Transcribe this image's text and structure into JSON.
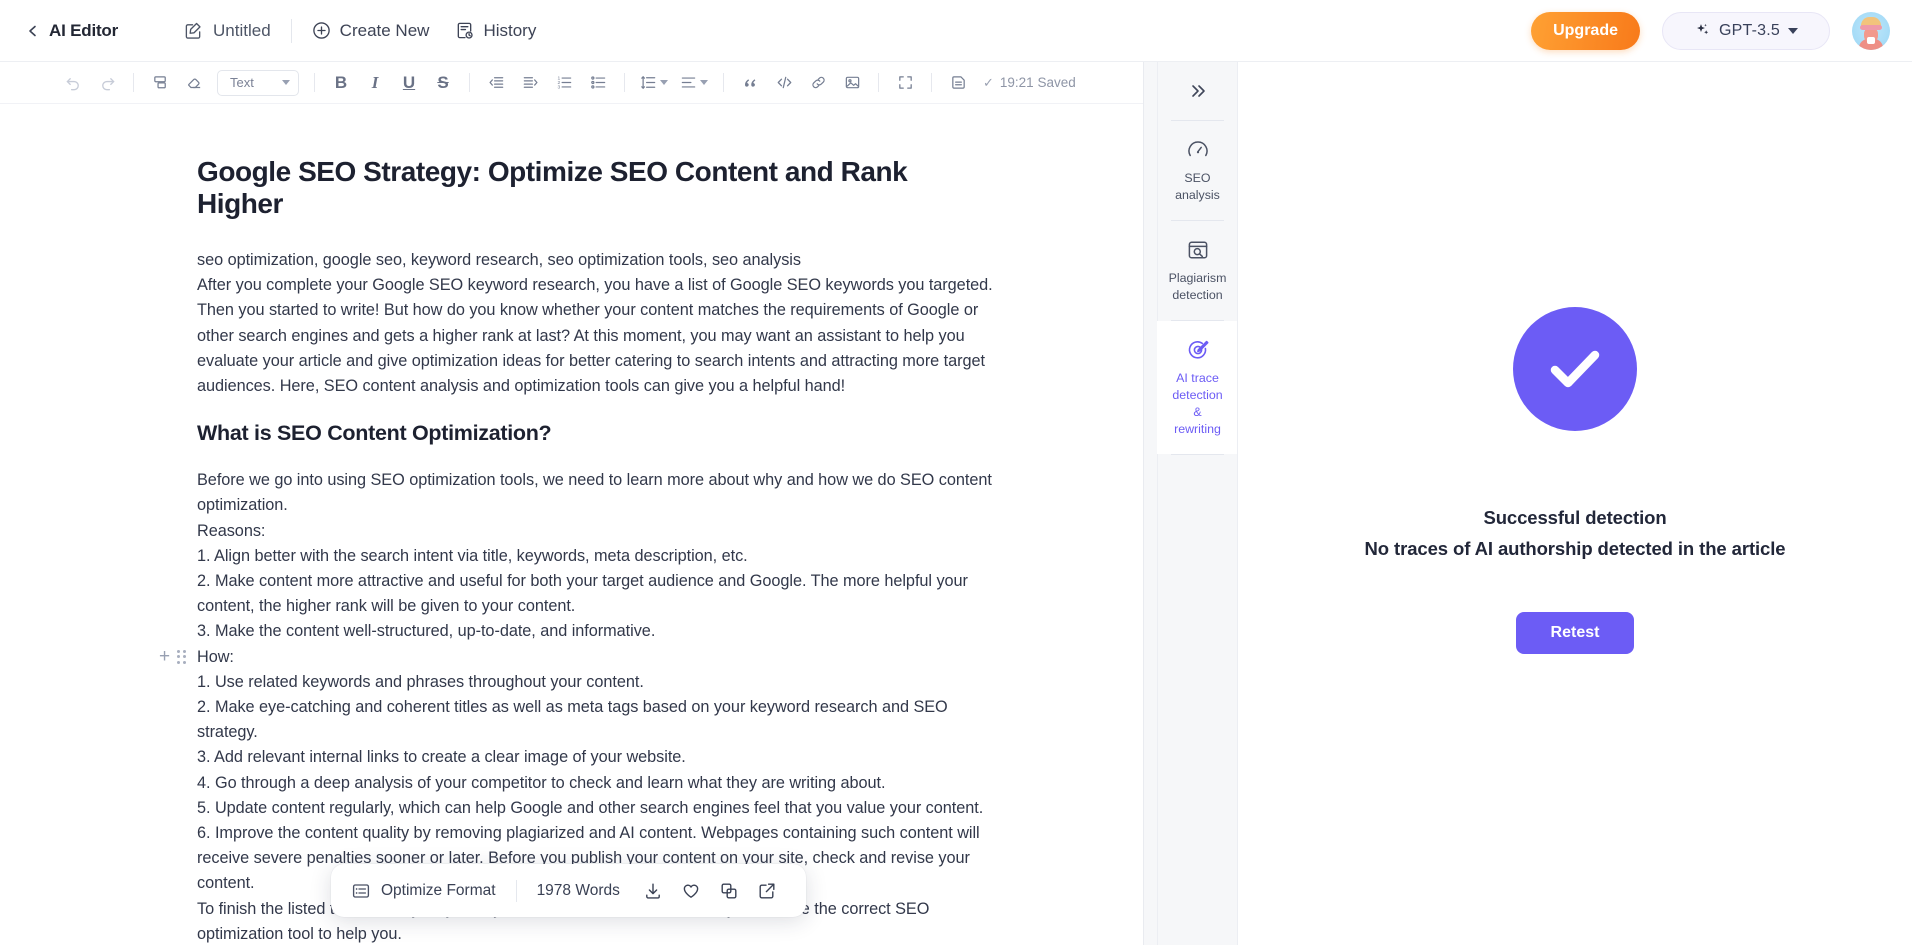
{
  "header": {
    "back_icon": "chevron-left-icon",
    "app_title": "AI Editor",
    "doc_icon": "edit-square-icon",
    "doc_name": "Untitled",
    "create_new_icon": "plus-circle-icon",
    "create_new_label": "Create New",
    "history_icon": "history-icon",
    "history_label": "History",
    "upgrade_label": "Upgrade",
    "model_icon": "sparkle-icon",
    "model_label": "GPT-3.5",
    "avatar": "user-avatar"
  },
  "toolbar": {
    "undo": "undo-icon",
    "redo": "redo-icon",
    "format_painter": "format-painter-icon",
    "clear_format": "eraser-icon",
    "style_value": "Text",
    "bold": "B",
    "italic": "I",
    "underline": "U",
    "strikethrough": "S",
    "outdent": "outdent-icon",
    "indent": "indent-icon",
    "ordered_list": "ordered-list-icon",
    "bullet_list": "bullet-list-icon",
    "line_height": "line-height-icon",
    "align": "align-icon",
    "quote": "quote-icon",
    "code": "code-icon",
    "link": "link-icon",
    "image": "image-icon",
    "fullscreen": "fullscreen-icon",
    "save": "save-icon",
    "saved_status": "19:21 Saved",
    "saved_check": "✓"
  },
  "document": {
    "title": "Google SEO Strategy: Optimize SEO Content and Rank Higher",
    "keywords_line": "seo optimization, google seo, keyword research, seo optimization tools, seo analysis",
    "intro_paragraph": "After you complete your Google SEO keyword research, you have a list of Google SEO keywords you targeted. Then you started to write! But how do you know whether your content matches the requirements of Google or other search engines and gets a higher rank at last? At this moment, you may want an assistant to help you evaluate your article and give optimization ideas for better catering to search intents and attracting more target audiences. Here, SEO content analysis and optimization tools can give you a helpful hand!",
    "heading2": "What is SEO Content Optimization?",
    "lines": [
      "Before we go into using SEO optimization tools, we need to learn more about why and how we do SEO content optimization.",
      "Reasons:",
      "1. Align better with the search intent via title, keywords, meta description, etc.",
      "2. Make content more attractive and useful for both your target audience and Google. The more helpful your content, the higher rank will be given to your content.",
      "3. Make the content well-structured, up-to-date, and informative.",
      "How:",
      "1. Use related keywords and phrases throughout your content.",
      "2. Make eye-catching and coherent titles as well as meta tags based on your keyword research and SEO strategy.",
      "3. Add relevant internal links to create a clear image of your website.",
      "4. Go through a deep analysis of your competitor to check and learn what they are writing about.",
      "5. Update content regularly, which can help Google and other search engines feel that you value your content.",
      "6. Improve the content quality by removing plagiarized and AI content. Webpages containing such content will receive severe penalties sooner or later. Before you publish your content on your site, check and revise your content.",
      "To finish the listed tasks, it may only take you less than an hour to make if you choose the correct SEO optimization tool to help you."
    ],
    "gutter": {
      "add_icon": "plus-icon",
      "drag_icon": "drag-handle-icon"
    }
  },
  "float_bar": {
    "optimize_icon": "list-format-icon",
    "optimize_label": "Optimize Format",
    "word_count": "1978 Words",
    "download_icon": "download-icon",
    "favorite_icon": "heart-icon",
    "copy_icon": "copy-icon",
    "share_icon": "external-link-icon"
  },
  "rail": {
    "collapse_icon": "chevrons-right-icon",
    "tabs": [
      {
        "icon": "gauge-icon",
        "line1": "SEO",
        "line2": "analysis",
        "active": false
      },
      {
        "icon": "plagiarism-search-icon",
        "line1": "Plagiarism",
        "line2": "detection",
        "active": false
      },
      {
        "icon": "ai-trace-pen-icon",
        "line1": "AI trace",
        "line2": "detection",
        "line3": "&",
        "line4": "rewriting",
        "active": true
      }
    ]
  },
  "result": {
    "status_icon": "check-circle-icon",
    "title": "Successful detection",
    "subtitle": "No traces of AI authorship detected in the article",
    "retest_label": "Retest"
  },
  "colors": {
    "accent_purple": "#6c5cf5",
    "upgrade_orange": "#fb8b26",
    "text_dark": "#222739",
    "rail_bg": "#f6f7f9"
  }
}
